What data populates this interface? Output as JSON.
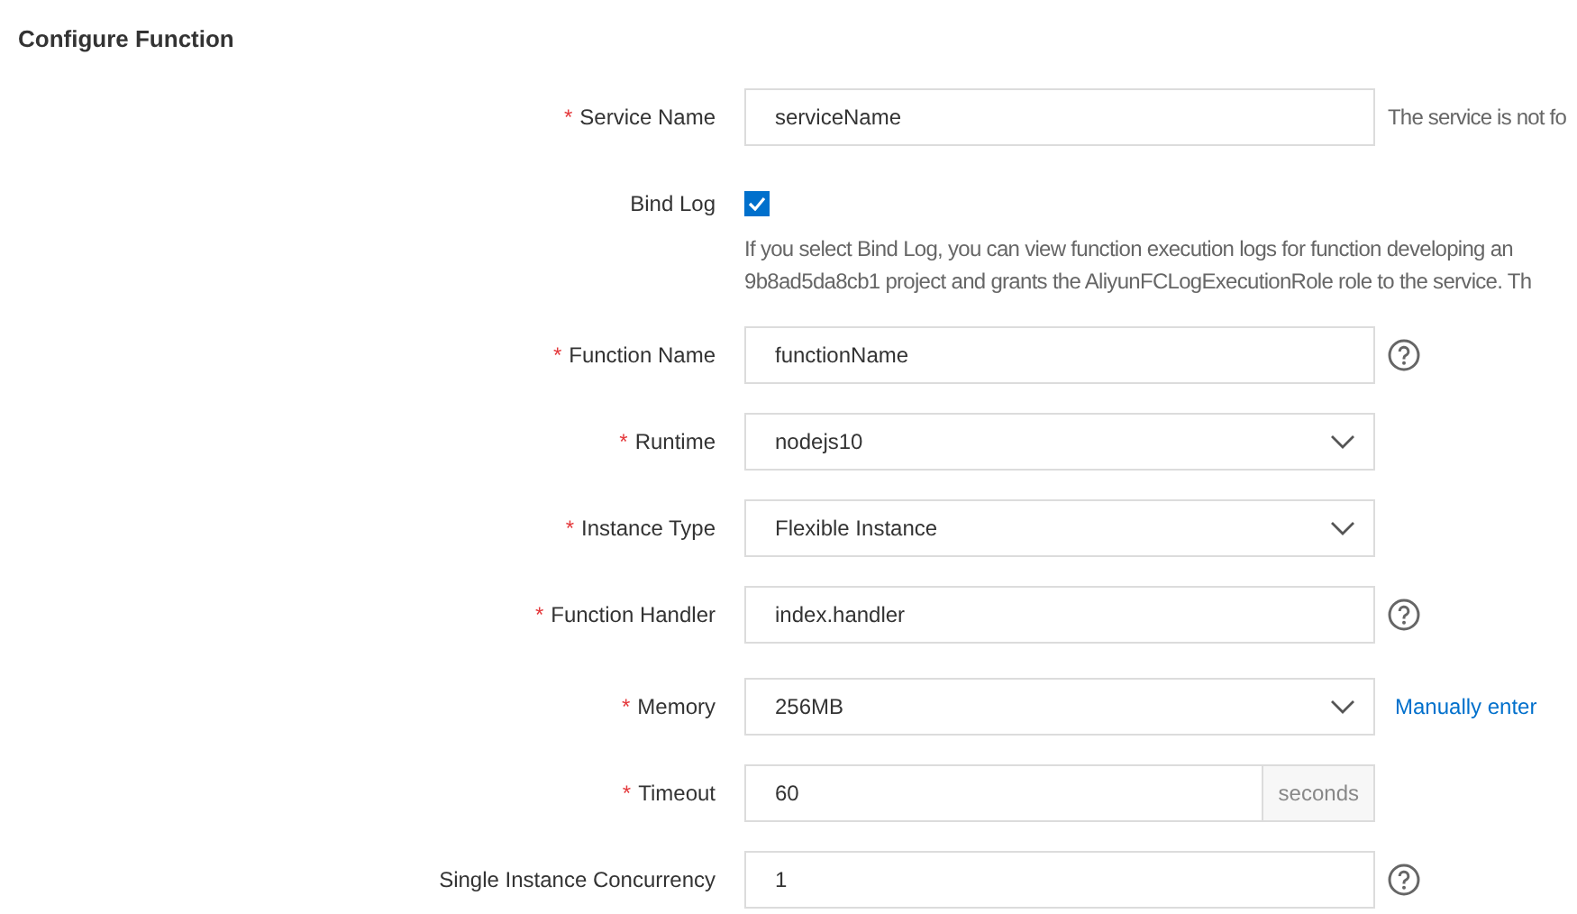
{
  "title": "Configure Function",
  "fields": [
    {
      "kind": "text",
      "label": "Service Name",
      "required": "*",
      "value": "serviceName",
      "side_text": "The service is not fo"
    },
    {
      "kind": "checkbox",
      "label": "Bind Log",
      "checked": true,
      "note": [
        "If you select Bind Log, you can view function execution logs for function developing an",
        "9b8ad5da8cb1 project and grants the AliyunFCLogExecutionRole role to the service. Th"
      ]
    },
    {
      "kind": "text",
      "label": "Function Name",
      "required": "*",
      "value": "functionName",
      "help": true
    },
    {
      "kind": "select",
      "label": "Runtime",
      "required": "*",
      "value": "nodejs10"
    },
    {
      "kind": "select",
      "label": "Instance Type",
      "required": "*",
      "value": "Flexible Instance"
    },
    {
      "kind": "text",
      "label": "Function Handler",
      "required": "*",
      "value": "index.handler",
      "help": true
    },
    {
      "kind": "select",
      "label": "Memory",
      "required": "*",
      "value": "256MB",
      "link": "Manually enter"
    },
    {
      "kind": "addon",
      "label": "Timeout",
      "required": "*",
      "value": "60",
      "addon": "seconds"
    },
    {
      "kind": "text",
      "label": "Single Instance Concurrency",
      "value": "1",
      "help": true
    }
  ]
}
